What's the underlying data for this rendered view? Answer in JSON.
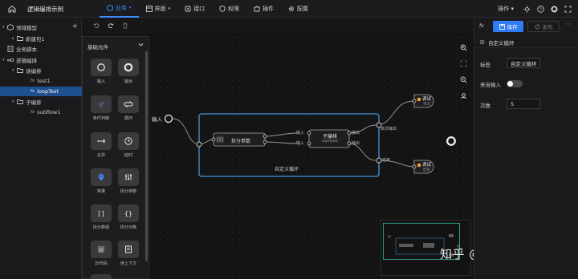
{
  "app": {
    "title": "逻辑编排示例"
  },
  "nav": [
    {
      "label": "业务",
      "icon": "cube-icon",
      "active": true
    },
    {
      "label": "界面",
      "icon": "layout-icon",
      "active": false
    },
    {
      "label": "接口",
      "icon": "api-icon",
      "active": false
    },
    {
      "label": "权限",
      "icon": "shield-icon",
      "active": false
    },
    {
      "label": "插件",
      "icon": "puzzle-icon",
      "active": false
    },
    {
      "label": "配置",
      "icon": "gear-icon",
      "active": false
    }
  ],
  "topright": {
    "operate": "操作",
    "icons": [
      "sun-icon",
      "help-icon",
      "github-icon",
      "fullscreen-icon"
    ]
  },
  "tree": [
    {
      "label": "领域模型",
      "level": 0,
      "caret": "▾",
      "icon": "cube-icon"
    },
    {
      "label": "新建包1",
      "level": 1,
      "caret": "▸",
      "icon": "folder-icon"
    },
    {
      "label": "业务脚本",
      "level": 0,
      "caret": "",
      "icon": "script-icon"
    },
    {
      "label": "逻辑编排",
      "level": 0,
      "caret": "▾",
      "icon": "flow-icon"
    },
    {
      "label": "读编排",
      "level": 1,
      "caret": "▾",
      "icon": "folder-icon"
    },
    {
      "label": "test1",
      "level": 2,
      "caret": "",
      "fx": "fx"
    },
    {
      "label": "loopTest",
      "level": 2,
      "caret": "",
      "fx": "fx",
      "selected": true
    },
    {
      "label": "子编排",
      "level": 1,
      "caret": "▾",
      "icon": "folder-icon"
    },
    {
      "label": "subflow1",
      "level": 2,
      "caret": "",
      "fx": "fx"
    }
  ],
  "palette": {
    "title": "基础元件",
    "items": [
      {
        "label": "输入",
        "icon": "circle-icon"
      },
      {
        "label": "输出",
        "icon": "ring-icon"
      },
      {
        "label": "条件判断",
        "icon": "branch-icon"
      },
      {
        "label": "循环",
        "icon": "loop-icon"
      },
      {
        "label": "合并",
        "icon": "merge-icon"
      },
      {
        "label": "延时",
        "icon": "clock-icon"
      },
      {
        "label": "常量",
        "icon": "pin-icon"
      },
      {
        "label": "拆分参数",
        "icon": "split-icon"
      },
      {
        "label": "拆分数组",
        "icon": "brackets-icon"
      },
      {
        "label": "拆分对象",
        "icon": "braces-icon"
      },
      {
        "label": "JS代码",
        "icon": "js-icon"
      },
      {
        "label": "读上下文",
        "icon": "context-icon"
      }
    ]
  },
  "flow": {
    "input_label": "输入",
    "loop_label": "自定义循环",
    "split_node": "拆分参数",
    "sub_node": {
      "title": "子编排",
      "subtitle": "subflow1"
    },
    "port_in": "输入",
    "port_out": "输出",
    "port_each": "单次输出",
    "port_end": "结束",
    "debug1": {
      "title": "调试",
      "subtitle": "单次"
    },
    "debug2": {
      "title": "调试",
      "subtitle": "结束"
    }
  },
  "canvas_controls": [
    "zoom-in-icon",
    "fit-icon",
    "zoom-out-icon",
    "locate-icon"
  ],
  "watermark": "知乎 @悠闲的水",
  "panel": {
    "fx": "fx",
    "save": "保存",
    "publish": "发布",
    "section": "自定义循环",
    "fields": [
      {
        "label": "标签",
        "value": "自定义循环"
      },
      {
        "label": "来自输入",
        "toggle": false
      },
      {
        "label": "次数",
        "value": "5"
      }
    ]
  }
}
